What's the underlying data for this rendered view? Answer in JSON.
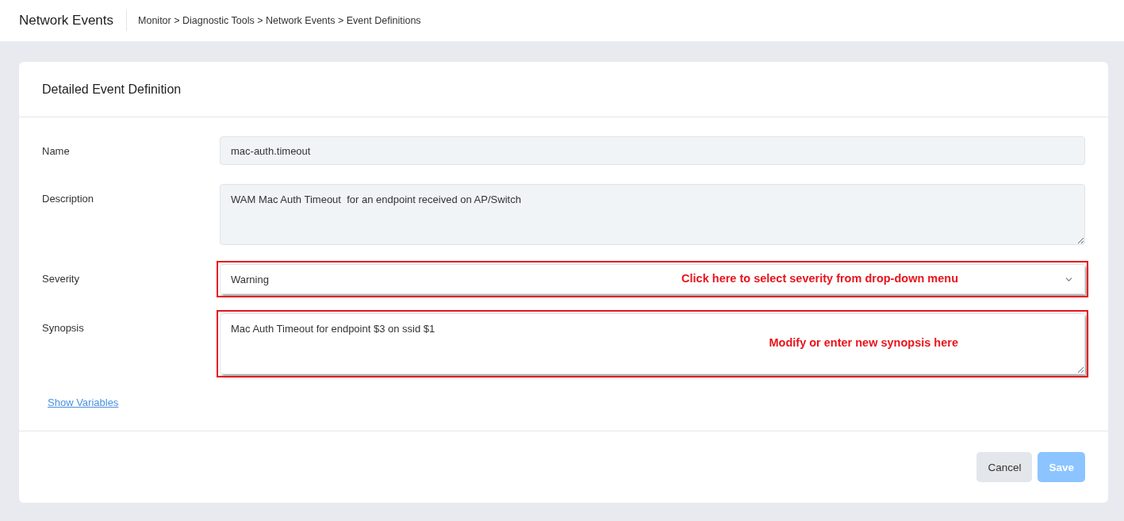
{
  "header": {
    "title": "Network Events",
    "breadcrumb": "Monitor > Diagnostic Tools > Network Events > Event Definitions"
  },
  "card": {
    "title": "Detailed Event Definition",
    "fields": [
      {
        "kind": "input",
        "label": "Name",
        "value": "mac-auth.timeout",
        "disabled": true,
        "highlighted": false
      },
      {
        "kind": "textarea",
        "label": "Description",
        "value": "WAM Mac Auth Timeout  for an endpoint received on AP/Switch",
        "disabled": true,
        "highlighted": false
      },
      {
        "kind": "select",
        "label": "Severity",
        "value": "Warning",
        "disabled": false,
        "highlighted": true,
        "annotation": "Click here to select severity from drop-down menu"
      },
      {
        "kind": "textarea",
        "label": "Synopsis",
        "value": "Mac Auth Timeout for endpoint $3 on ssid $1",
        "disabled": false,
        "highlighted": true,
        "annotation": "Modify or enter new synopsis here"
      }
    ],
    "link": "Show Variables",
    "buttons": [
      {
        "label": "Cancel",
        "kind": "secondary",
        "disabled": false
      },
      {
        "label": "Save",
        "kind": "primary",
        "disabled": true
      }
    ]
  }
}
